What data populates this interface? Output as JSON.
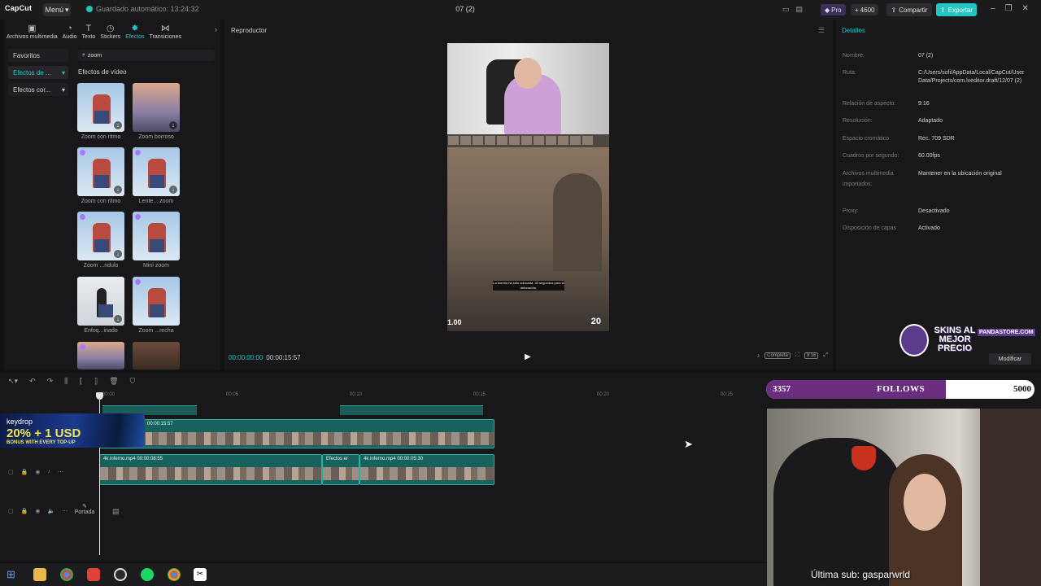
{
  "topbar": {
    "app_name": "CapCut",
    "menu_label": "Menú",
    "autosave_text": "Guardado automático: 13:24:32",
    "project_title": "07 (2)",
    "pro_label": "Pro",
    "credits": "4600",
    "share_label": "Compartir",
    "export_label": "Exportar"
  },
  "media_tabs": [
    {
      "label": "Archivos multimedia",
      "icon": "media-icon"
    },
    {
      "label": "Audio",
      "icon": "audio-icon"
    },
    {
      "label": "Texto",
      "icon": "text-icon"
    },
    {
      "label": "Stickers",
      "icon": "sticker-icon"
    },
    {
      "label": "Efectos",
      "icon": "effects-icon",
      "active": true
    },
    {
      "label": "Transiciones",
      "icon": "transitions-icon"
    }
  ],
  "categories": [
    "Favoritos",
    "Efectos de ...",
    "Efectos cor..."
  ],
  "search": {
    "value": "zoom"
  },
  "effects_section_title": "Efectos de vídeo",
  "effects": [
    {
      "label": "Zoom con ritmo",
      "thumb": "sky"
    },
    {
      "label": "Zoom borroso",
      "thumb": "city"
    },
    {
      "label": "Zoom con ritmo",
      "thumb": "sky"
    },
    {
      "label": "Lente... zoom",
      "thumb": "sky"
    },
    {
      "label": "Zoom ...ndulo",
      "thumb": "sky"
    },
    {
      "label": "Mini zoom",
      "thumb": "sky"
    },
    {
      "label": "Enfoq...inado",
      "thumb": "white"
    },
    {
      "label": "Zoom ...recha",
      "thumb": "sky"
    },
    {
      "label": "",
      "thumb": "city"
    },
    {
      "label": "",
      "thumb": "tv"
    }
  ],
  "player": {
    "title": "Reproductor",
    "current_time": "00:00:00:00",
    "total_time": "00:00:15:57",
    "complete_label": "Completa",
    "ratio_label": "9:16",
    "video_caption": "La bomba ha sido colocada. 40 segundos para la detonación.",
    "hud_left": "1.00",
    "hud_right": "20"
  },
  "details": {
    "title": "Detalles",
    "rows": [
      {
        "key": "Nombre:",
        "value": "07 (2)"
      },
      {
        "key": "Ruta:",
        "value": "C:/Users/sofi/AppData/Local/CapCut/User Data/Projects/com.lveditor.draft/12/07 (2)"
      },
      {
        "key": "Relación de aspecto:",
        "value": "9:16"
      },
      {
        "key": "Resolución:",
        "value": "Adaptado"
      },
      {
        "key": "Espacio cromático",
        "value": "Rec. 709 SDR"
      },
      {
        "key": "Cuadros por segundo:",
        "value": "60.00fps"
      },
      {
        "key": "Archivos multimedia importados:",
        "value": "Mantener en la ubicación original"
      },
      {
        "key": "Proxy:",
        "value": "Desactivado"
      },
      {
        "key": "Disposición de capas",
        "value": "Activado"
      }
    ],
    "modify_label": "Modificar"
  },
  "timeline": {
    "ruler": [
      "00:00",
      "00:05",
      "00:10",
      "00:15",
      "00:20",
      "00:25"
    ],
    "clip_top_label": "00:00:15:57",
    "clip_main_label1": "4k inferno.mp4  00:00:08:55",
    "clip_fx_label": "Efectos er",
    "clip_main_label2": "4k inferno.mp4  00:00:05:30",
    "cover_label": "Portada"
  },
  "overlays": {
    "keydrop_brand": "keydrop",
    "keydrop_big": "20% + 1 USD",
    "keydrop_small": "BONUS WITH EVERY TOP-UP",
    "skins_line": "SKINS AL MEJOR PRECIO",
    "skins_site": "PANDASTORE.COM",
    "follows_current": "3357",
    "follows_label": "FOLLOWS",
    "follows_goal": "5000",
    "follows_progress": 0.671,
    "last_sub": "Última sub: gasparwrld"
  },
  "colors": {
    "accent": "#22c7c4",
    "purple": "#6b2e7e"
  }
}
